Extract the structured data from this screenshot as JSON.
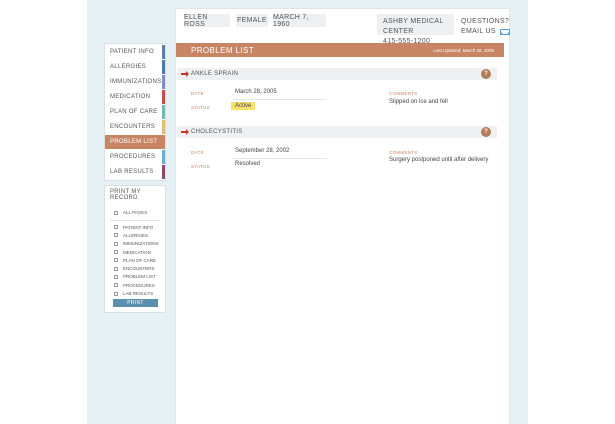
{
  "patient": {
    "name": "ELLEN ROSS",
    "gender": "FEMALE",
    "dob": "MARCH 7, 1960"
  },
  "clinic": {
    "name": "ASHBY MEDICAL CENTER",
    "phone": "415-555-1200"
  },
  "contact": {
    "questions": "QUESTIONS?",
    "email": "EMAIL US",
    "email_icon": "envelope-icon"
  },
  "nav": {
    "items": [
      {
        "label": "PATIENT INFO",
        "color": "#5b7fa8"
      },
      {
        "label": "ALLERGIES",
        "color": "#4f79a6"
      },
      {
        "label": "IMMUNIZATIONS",
        "color": "#7d8fc4"
      },
      {
        "label": "MEDICATION",
        "color": "#c0504d"
      },
      {
        "label": "PLAN OF CARE",
        "color": "#78b5b3"
      },
      {
        "label": "ENCOUNTERS",
        "color": "#d8c274"
      },
      {
        "label": "PROBLEM LIST",
        "color": "#c88563"
      },
      {
        "label": "PROCEDURES",
        "color": "#6aaed2"
      },
      {
        "label": "LAB RESULTS",
        "color": "#8a4b68"
      }
    ],
    "active_index": 6
  },
  "print": {
    "title": "PRINT MY RECORD",
    "all_pages": "ALL PAGES",
    "options": [
      "PATIENT INFO",
      "ALLERGIES",
      "IMMUNIZATIONS",
      "MEDICATION",
      "PLAN OF CARE",
      "ENCOUNTERS",
      "PROBLEM LIST",
      "PROCEDURES",
      "LAB RESULTS"
    ],
    "button": "PRINT"
  },
  "header": {
    "title": "PROBLEM LIST",
    "updated": "Last Updated: March 28, 2005"
  },
  "labels": {
    "date": "DATE",
    "status": "STATUS",
    "comments": "COMMENTS"
  },
  "problems": [
    {
      "name": "ANKLE SPRAIN",
      "date": "March 28, 2005",
      "status": "Active",
      "comments": "Slipped on ice and fell"
    },
    {
      "name": "CHOLECYSTITIS",
      "date": "September 28, 2002",
      "status": "Resolved",
      "comments": "Surgery postponed until after delivery"
    }
  ],
  "colors": {
    "accent": "#c88563",
    "print_button": "#5b8fae",
    "active_badge": "#f6e26b",
    "backdrop": "#e6f1f5"
  }
}
